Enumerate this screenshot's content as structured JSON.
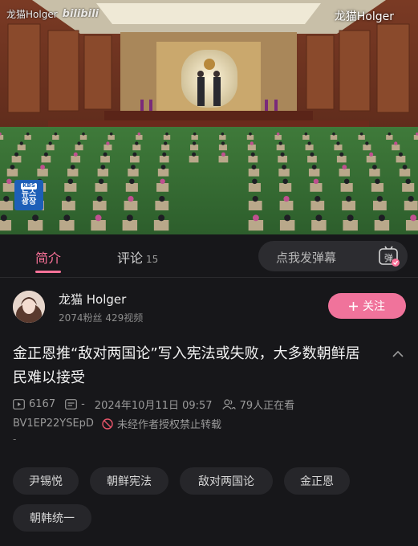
{
  "video": {
    "watermark_left": "龙猫Holger",
    "watermark_bili": "bilibili",
    "watermark_right": "龙猫Holger",
    "news_logo_top": "KBS",
    "news_logo_line1": "뉴스",
    "news_logo_line2": "광장"
  },
  "tabs": {
    "intro": "简介",
    "comments": "评论",
    "comments_count": "15",
    "danmaku_placeholder": "点我发弹幕",
    "danmaku_button": "弹"
  },
  "uploader": {
    "name": "龙猫 Holger",
    "stats": "2074粉丝  429视频",
    "follow_label": "关注",
    "follow_icon": "plus-icon"
  },
  "video_info": {
    "title": "金正恩推“敌对两国论”写入宪法或失败，大多数朝鲜居民难以接受",
    "play_count": "6167",
    "danmaku_count": "-",
    "date": "2024年10月11日 09:57",
    "watching": "79人正在看",
    "bvid": "BV1EP22YSEpD",
    "copyright": "未经作者授权禁止转载",
    "desc": "-"
  },
  "tags": [
    "尹锡悦",
    "朝鲜宪法",
    "敌对两国论",
    "金正恩",
    "朝韩统一"
  ],
  "colors": {
    "accent": "#fb7299",
    "follow_bg": "#f0739b",
    "background": "#17171a",
    "tag_bg": "#26262a"
  }
}
